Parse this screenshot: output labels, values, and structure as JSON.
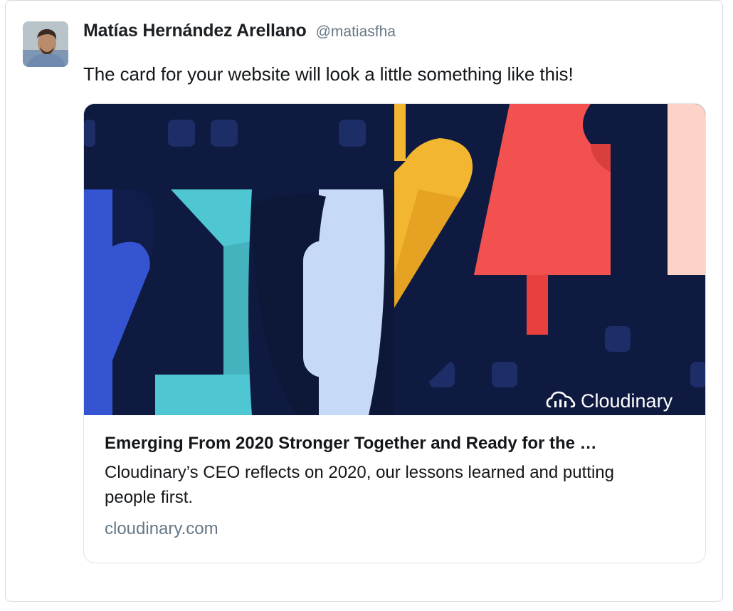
{
  "tweet": {
    "author_name": "Matías Hernández Arellano",
    "author_handle": "@matiasfha",
    "text": "The card for your website will look a little something like this!"
  },
  "card": {
    "image": {
      "logo_text": "Cloudinary",
      "digits": [
        "2",
        "0",
        "2",
        "1"
      ],
      "colors": {
        "background": "#0f1a40",
        "blue": "#3554d1",
        "teal": "#4ec7d3",
        "light_blue": "#c6d9f6",
        "yellow": "#f3b630",
        "red": "#f2514f",
        "peach": "#fcd3c6"
      }
    },
    "title": "Emerging From 2020 Stronger Together and Ready for the …",
    "description": "Cloudinary’s CEO reflects on 2020, our lessons learned and putting people first.",
    "domain": "cloudinary.com"
  },
  "icons": {
    "avatar": "profile-photo",
    "logo": "cloudinary-cloud-icon"
  }
}
